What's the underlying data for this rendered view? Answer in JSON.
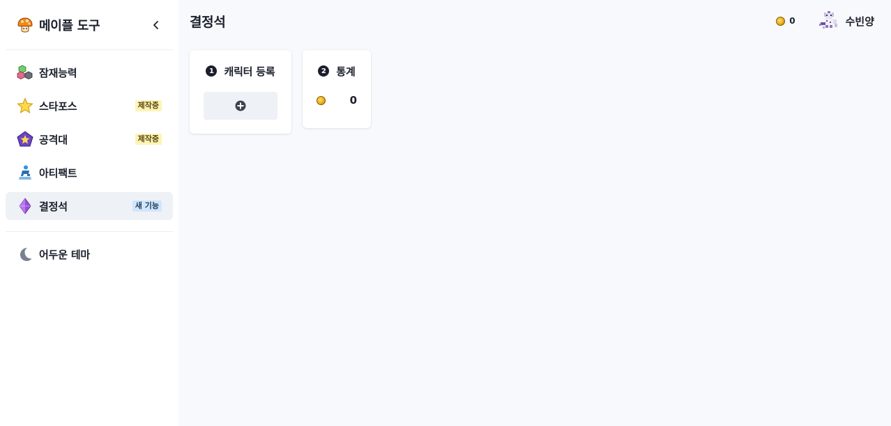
{
  "brand": {
    "title": "메이플 도구",
    "icon": "mushroom-icon"
  },
  "sidebar": {
    "items": [
      {
        "label": "잠재능력",
        "icon": "cubes-icon",
        "badge": ""
      },
      {
        "label": "스타포스",
        "icon": "star-icon",
        "badge": "제작중"
      },
      {
        "label": "공격대",
        "icon": "pentagon-star-icon",
        "badge": "제작중"
      },
      {
        "label": "아티팩트",
        "icon": "figure-icon",
        "badge": ""
      },
      {
        "label": "결정석",
        "icon": "crystal-icon",
        "badge": "새 기능",
        "active": true
      }
    ],
    "theme_label": "어두운 테마"
  },
  "header": {
    "title": "결정석",
    "coin_total": "0",
    "user_name": "수빈양"
  },
  "cards": {
    "register": {
      "step": "1",
      "title": "캐릭터 등록"
    },
    "stats": {
      "step": "2",
      "title": "통계",
      "value": "0"
    }
  },
  "colors": {
    "sidebar_bg": "#ffffff",
    "main_bg": "#f7f9fc",
    "active_bg": "#eef1f5",
    "badge_wip_bg": "#fdf3b7",
    "badge_new_bg": "#cfe6fb"
  }
}
